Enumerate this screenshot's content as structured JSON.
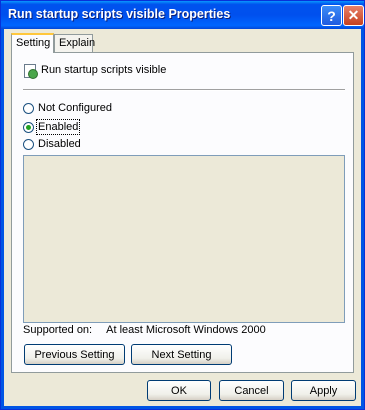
{
  "window": {
    "title": "Run startup scripts visible Properties",
    "help_glyph": "?",
    "close_glyph": "✕"
  },
  "tabs": [
    {
      "label": "Setting"
    },
    {
      "label": "Explain"
    }
  ],
  "policy": {
    "name": "Run startup scripts visible"
  },
  "radios": [
    {
      "label": "Not Configured",
      "checked": false
    },
    {
      "label": "Enabled",
      "checked": true
    },
    {
      "label": "Disabled",
      "checked": false
    }
  ],
  "supported": {
    "label": "Supported on:",
    "value": "At least Microsoft Windows 2000"
  },
  "buttons": {
    "previous": "Previous Setting",
    "next": "Next Setting",
    "ok": "OK",
    "cancel": "Cancel",
    "apply": "Apply"
  },
  "colors": {
    "titlebar": "#0053EE",
    "dialog_bg": "#ECE9D8",
    "close_button": "#C6411F"
  }
}
